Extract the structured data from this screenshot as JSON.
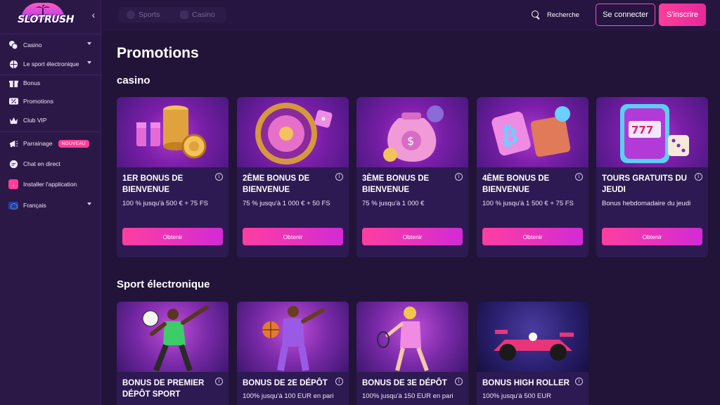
{
  "brand": {
    "logo_text": "SLOTRUSH"
  },
  "sidebar": {
    "items": [
      {
        "label": "Casino",
        "icon": "casino-chips-icon",
        "has_caret": true
      },
      {
        "label": "Le sport électronique",
        "icon": "ball-icon",
        "has_caret": true
      },
      {
        "label": "Bonus",
        "icon": "gift-icon"
      },
      {
        "label": "Promotions",
        "icon": "percent-ticket-icon"
      },
      {
        "label": "Club VIP",
        "icon": "crown-icon"
      },
      {
        "label": "Parrainage",
        "icon": "megaphone-icon",
        "badge": "NOUVEAU"
      },
      {
        "label": "Chat en direct",
        "icon": "chat-bubble-icon"
      },
      {
        "label": "Installer l'application",
        "icon": "download-icon"
      },
      {
        "label": "Français",
        "icon": "eu-flag-icon",
        "has_caret": true
      }
    ]
  },
  "topbar": {
    "tabs": [
      {
        "label": "Sports"
      },
      {
        "label": "Casino"
      }
    ],
    "search_label": "Recherche",
    "login_label": "Se connecter",
    "signup_label": "S'inscrire"
  },
  "main": {
    "title": "Promotions",
    "casino_section": {
      "title": "casino",
      "cards": [
        {
          "title": "1ER BONUS DE BIENVENUE",
          "desc": "100 % jusqu'à 500 € + 75 FS",
          "button": "Obtenir",
          "art": "gift-coins"
        },
        {
          "title": "2ÈME BONUS DE BIENVENUE",
          "desc": "75 % jusqu'à 1 000 € + 50 FS",
          "button": "Obtenir",
          "art": "roulette"
        },
        {
          "title": "3ÈME BONUS DE BIENVENUE",
          "desc": "75 % jusqu'à 1 000 €",
          "button": "Obtenir",
          "art": "money-bag"
        },
        {
          "title": "4ÈME BONUS DE BIENVENUE",
          "desc": "100 % jusqu'à 1 500 € + 75 FS",
          "button": "Obtenir",
          "art": "bitcoin-wallet"
        },
        {
          "title": "TOURS GRATUITS DU JEUDI",
          "desc": "Bonus hebdomadaire du jeudi",
          "button": "Obtenir",
          "art": "slot-machine"
        }
      ]
    },
    "esport_section": {
      "title": "Sport électronique",
      "cards": [
        {
          "title": "BONUS DE PREMIER DÉPÔT SPORT",
          "desc": "",
          "art": "football-player"
        },
        {
          "title": "BONUS DE 2E DÉPÔT",
          "desc": "100% jusqu'à 100 EUR en pari",
          "art": "basketball-player"
        },
        {
          "title": "BONUS DE 3E DÉPÔT",
          "desc": "100% jusqu'à 150 EUR en pari",
          "art": "tennis-player"
        },
        {
          "title": "BONUS HIGH ROLLER",
          "desc": "100% jusqu'à 500 EUR",
          "art": "race-car"
        }
      ]
    }
  },
  "colors": {
    "accent": "#ff3d9a",
    "background": "#221338",
    "sidebar": "#2c1847",
    "card": "#2e1a52"
  }
}
